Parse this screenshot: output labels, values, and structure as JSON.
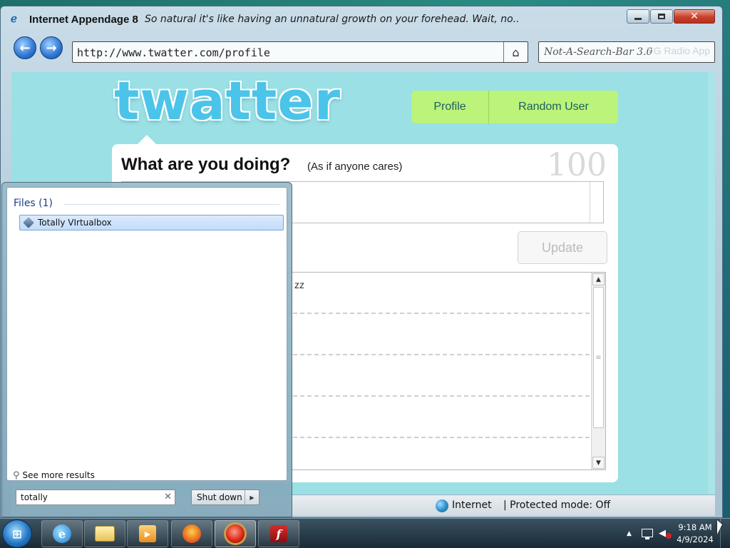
{
  "window": {
    "title": "Internet Appendage 8",
    "tagline": "So natural it's like having an unnatural growth on your forehead.  Wait, no..",
    "close_glyph": "✕"
  },
  "toolbar": {
    "back_glyph": "←",
    "forward_glyph": "→",
    "address": "http://www.twatter.com/profile",
    "home_glyph": "⌂",
    "search_placeholder": "Not-A-Search-Bar 3.0",
    "radio_app": "YG Radio App"
  },
  "page": {
    "logo": "twatter",
    "nav": [
      "Profile",
      "Random User"
    ],
    "prompt_heading": "What are you doing?",
    "prompt_sub": "(As if anyone cares)",
    "char_count": "100",
    "update_button": "Update",
    "timeline": [
      {
        "text": "zz"
      },
      {
        "text": ""
      },
      {
        "text": ""
      },
      {
        "text": ""
      },
      {
        "text": ""
      }
    ],
    "scroll_up": "▲",
    "scroll_down": "▼",
    "scroll_grip": "≡"
  },
  "statusbar": {
    "zone": "Internet",
    "protected_mode": "| Protected mode:  Off"
  },
  "start_menu": {
    "files_header": "Files (1)",
    "result_label": "Totally VIrtualbox",
    "see_more": "See more results",
    "search_value": "totally",
    "clear_glyph": "✕",
    "shutdown_label": "Shut down",
    "shutdown_arrow": "▶"
  },
  "taskbar": {
    "clock_time": "9:18 AM",
    "clock_date": "4/9/2024",
    "tray_arrow": "▲",
    "flash_glyph": "f",
    "ie_glyph": "e"
  },
  "colors": {
    "page_bg": "#9ae0e4",
    "logo": "#4bc4ea",
    "nav_bg": "#bcf37a",
    "nav_text": "#1c5f5f"
  }
}
